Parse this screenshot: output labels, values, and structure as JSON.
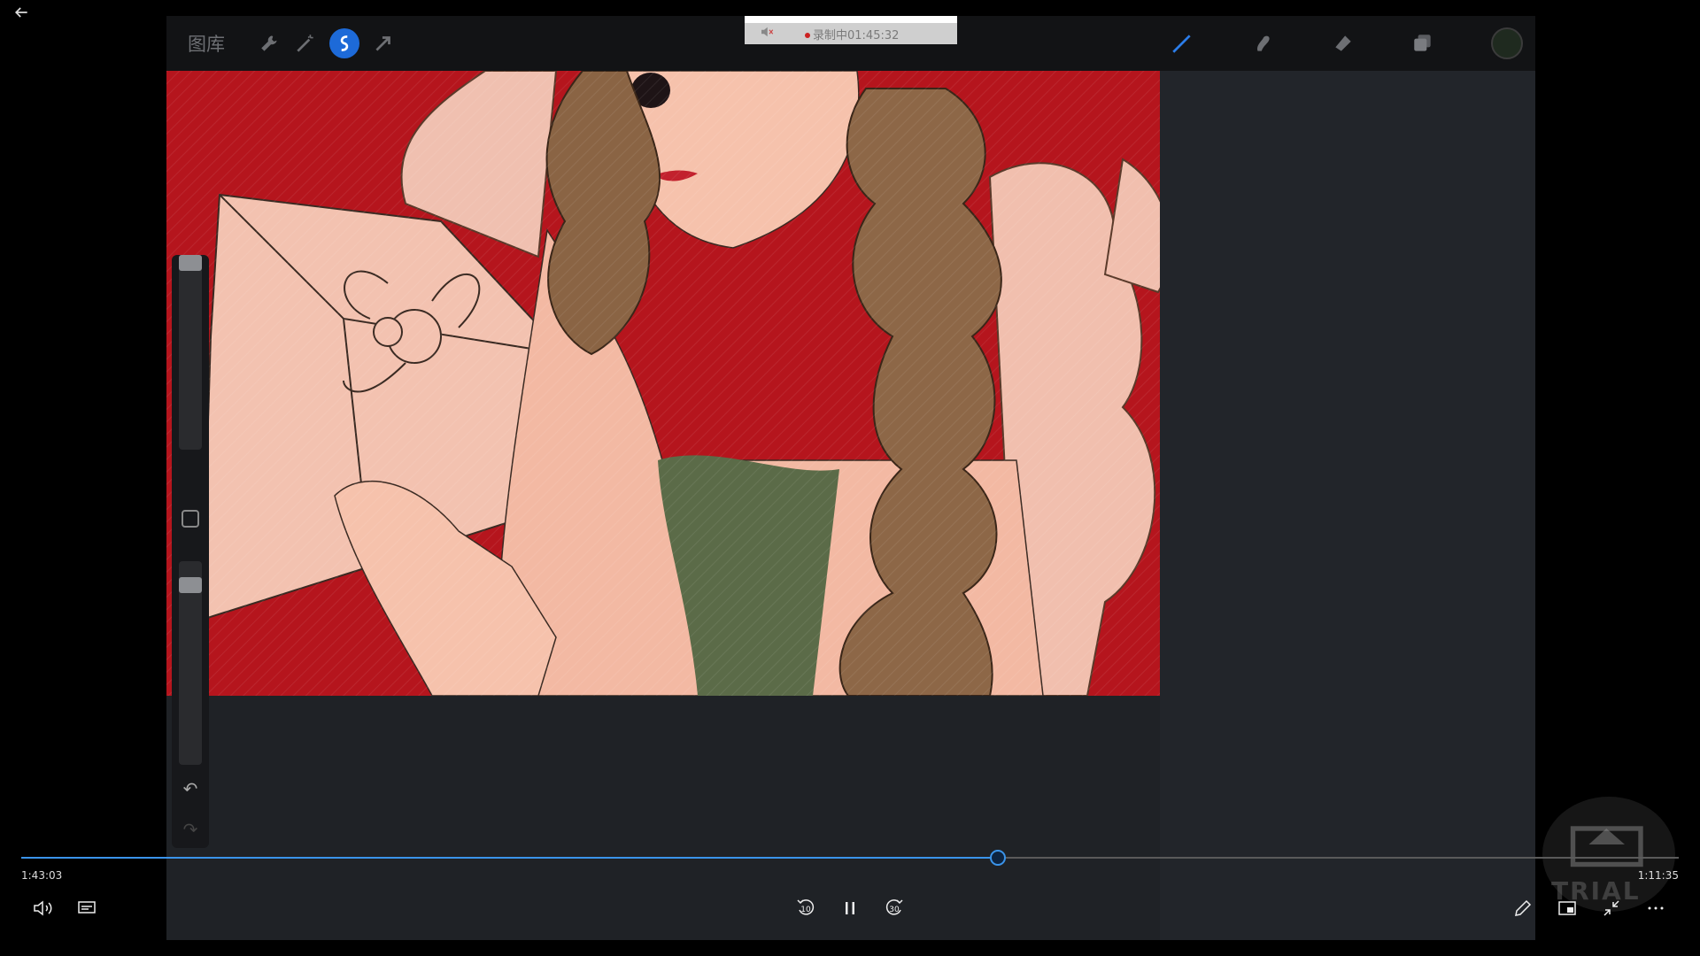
{
  "player": {
    "time_current": "1:43:03",
    "time_remaining": "1:11:35",
    "progress_percent": 58.9,
    "skip_back_seconds": "10",
    "skip_forward_seconds": "30"
  },
  "recording": {
    "status_text": "录制中01:45:32"
  },
  "procreate": {
    "gallery_label": "图库",
    "tools": [
      "wrench-icon",
      "magic-wand-icon",
      "selection-icon",
      "transform-icon"
    ],
    "brush_tools": [
      "brush-icon",
      "smudge-icon",
      "eraser-icon",
      "layers-icon"
    ],
    "current_color": "#1f2a1f",
    "active_tool_color": "#1d6ad8"
  },
  "watermark": {
    "text": "TRIAL"
  }
}
